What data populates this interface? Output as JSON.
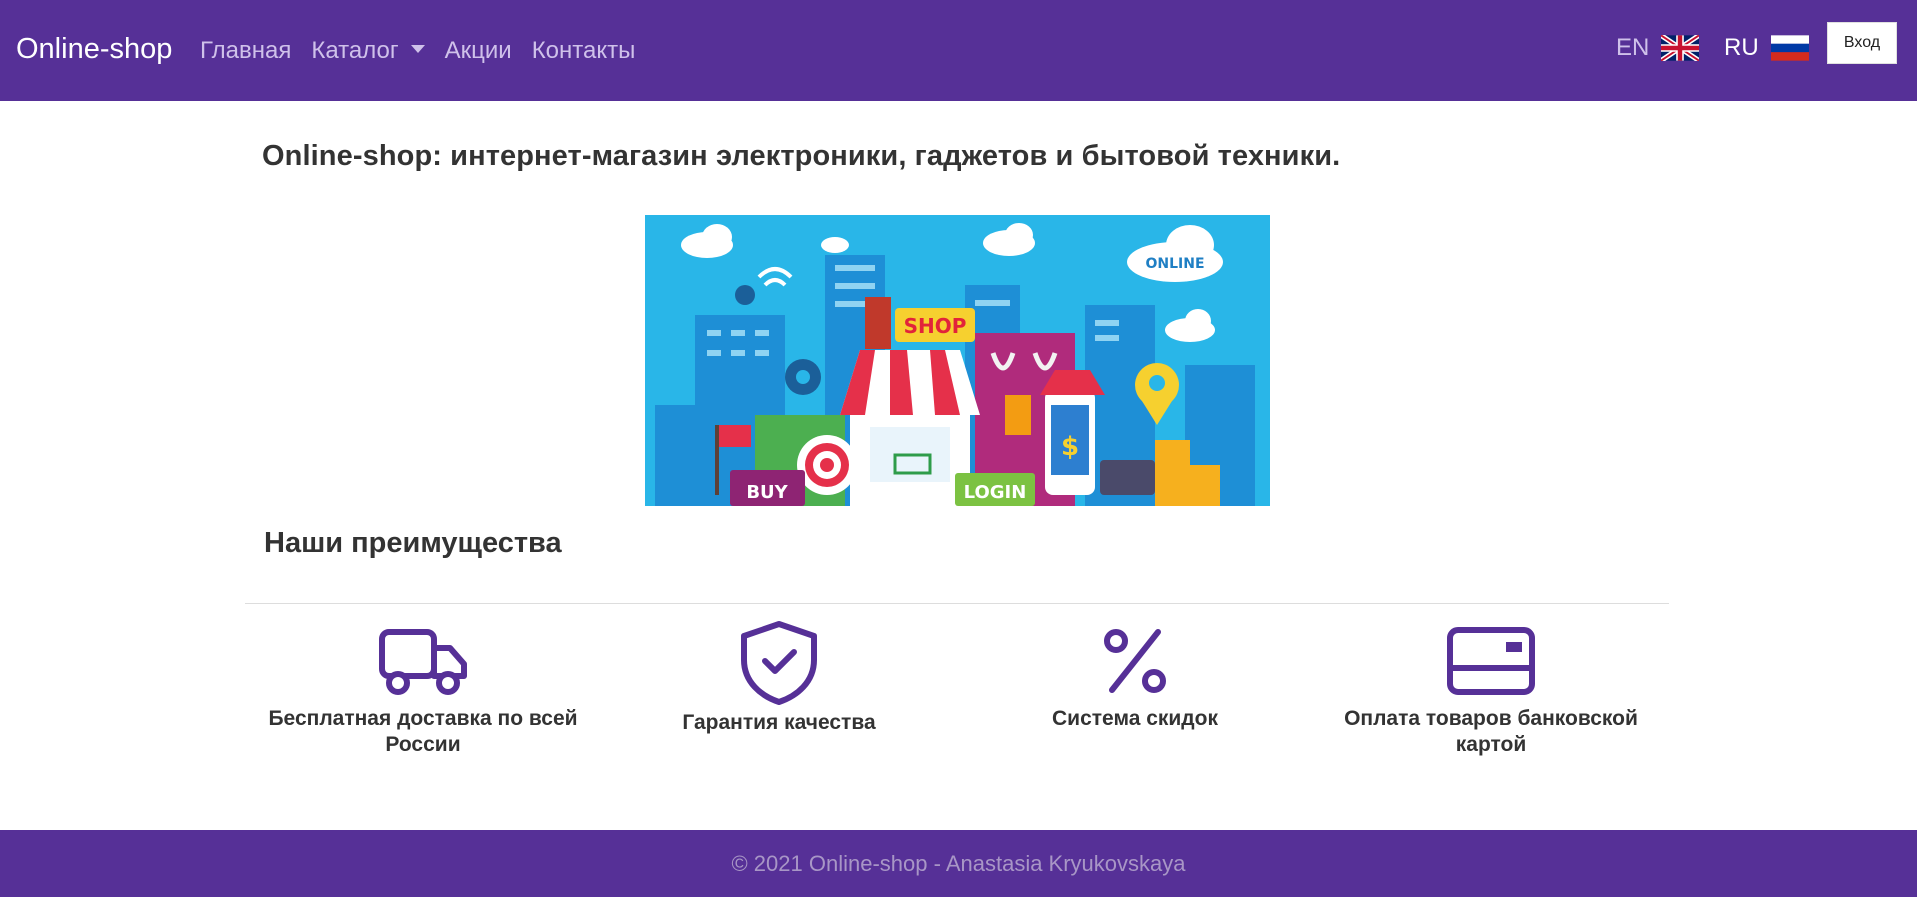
{
  "navbar": {
    "brand": "Online-shop",
    "links": [
      {
        "label": "Главная"
      },
      {
        "label": "Каталог"
      },
      {
        "label": "Акции"
      },
      {
        "label": "Контакты"
      }
    ],
    "languages": [
      {
        "label": "EN",
        "flag": "uk-flag-icon"
      },
      {
        "label": "RU",
        "flag": "russia-flag-icon"
      }
    ],
    "login_label": "Вход",
    "background_color": "#563097"
  },
  "main": {
    "title": "Online-shop: интернет-магазин электроники, гаджетов и бытовой техники.",
    "banner": {
      "shop_sign": "SHOP",
      "online_sign": "ONLINE",
      "buy_sign": "BUY",
      "login_sign": "LOGIN"
    },
    "advantages_title": "Наши преимущества",
    "features": [
      {
        "label": "Бесплатная доставка по всей России",
        "icon": "truck-icon"
      },
      {
        "label": "Гарантия качества",
        "icon": "shield-check-icon"
      },
      {
        "label": "Система скидок",
        "icon": "percent-icon"
      },
      {
        "label": "Оплата товаров банковской картой",
        "icon": "credit-card-icon"
      }
    ],
    "accent_color": "#563097"
  },
  "footer": {
    "text": "© 2021 Online-shop - Anastasia Kryukovskaya"
  }
}
